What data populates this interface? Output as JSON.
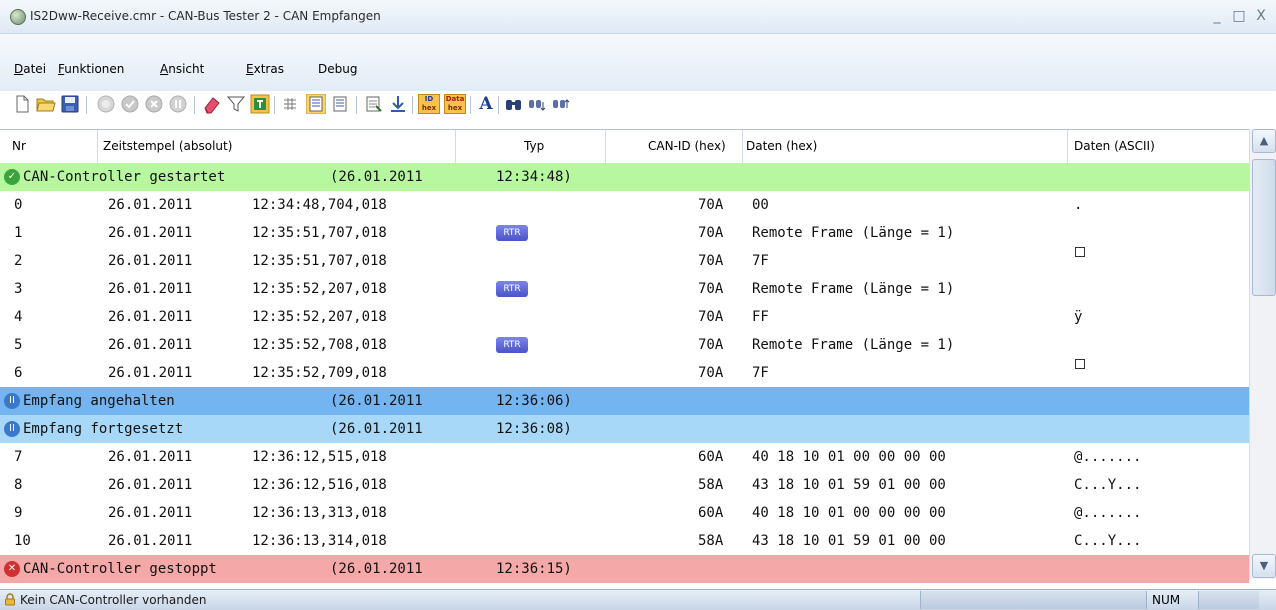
{
  "window": {
    "title": "IS2Dww-Receive.cmr - CAN-Bus Tester 2 - CAN Empfangen",
    "minimize": "_",
    "maximize": "□",
    "close": "X"
  },
  "menu": [
    {
      "label_u": "D",
      "label_rest": "atei"
    },
    {
      "label_u": "F",
      "label_rest": "unktionen"
    },
    {
      "label_u": "A",
      "label_rest": "nsicht"
    },
    {
      "label_u": "E",
      "label_rest": "xtras"
    },
    {
      "label_u": "",
      "label_rest": "Debug"
    }
  ],
  "toolbar": {
    "icons": [
      "new-file-icon",
      "open-folder-icon",
      "save-icon",
      "start-icon",
      "check-icon",
      "stop-icon",
      "pause-icon",
      "eraser-icon",
      "filter-icon",
      "trigger-icon",
      "grid-icon",
      "list-view-icon",
      "detail-view-icon",
      "export-icon",
      "download-icon",
      "id-hex-icon",
      "data-hex-icon",
      "font-icon",
      "find-icon",
      "find-next-icon",
      "find-prev-icon"
    ],
    "id_hex_top": "ID",
    "id_hex_bottom": "hex",
    "data_hex_top": "Data",
    "data_hex_bottom": "hex",
    "font_glyph": "A"
  },
  "columns": {
    "nr": "Nr",
    "timestamp": "Zeitstempel (absolut)",
    "type": "Typ",
    "can_id": "CAN-ID (hex)",
    "data_hex": "Daten (hex)",
    "data_ascii": "Daten (ASCII)"
  },
  "colors": {
    "started": "#b7f7a0",
    "paused": "#74b4f0",
    "resumed": "#a8d8f8",
    "stopped": "#f4a8a8",
    "rtr_badge": "#5a63d6"
  },
  "events": {
    "started": {
      "text": "CAN-Controller gestartet",
      "date": "(26.01.2011",
      "time": "12:34:48)"
    },
    "paused": {
      "text": "Empfang angehalten",
      "date": "(26.01.2011",
      "time": "12:36:06)"
    },
    "resumed": {
      "text": "Empfang fortgesetzt",
      "date": "(26.01.2011",
      "time": "12:36:08)"
    },
    "stopped": {
      "text": "CAN-Controller gestoppt",
      "date": "(26.01.2011",
      "time": "12:36:15)"
    }
  },
  "rtr_label": "RTR",
  "rows": [
    {
      "nr": "0",
      "date": "26.01.2011",
      "time": "12:34:48,704,018",
      "rtr": false,
      "id": "70A",
      "data": "00",
      "ascii": ".",
      "sq": false
    },
    {
      "nr": "1",
      "date": "26.01.2011",
      "time": "12:35:51,707,018",
      "rtr": true,
      "id": "70A",
      "data": "Remote Frame (Länge = 1)",
      "ascii": "",
      "sq": false
    },
    {
      "nr": "2",
      "date": "26.01.2011",
      "time": "12:35:51,707,018",
      "rtr": false,
      "id": "70A",
      "data": "7F",
      "ascii": "",
      "sq": true
    },
    {
      "nr": "3",
      "date": "26.01.2011",
      "time": "12:35:52,207,018",
      "rtr": true,
      "id": "70A",
      "data": "Remote Frame (Länge = 1)",
      "ascii": "",
      "sq": false
    },
    {
      "nr": "4",
      "date": "26.01.2011",
      "time": "12:35:52,207,018",
      "rtr": false,
      "id": "70A",
      "data": "FF",
      "ascii": "ÿ",
      "sq": false
    },
    {
      "nr": "5",
      "date": "26.01.2011",
      "time": "12:35:52,708,018",
      "rtr": true,
      "id": "70A",
      "data": "Remote Frame (Länge = 1)",
      "ascii": "",
      "sq": false
    },
    {
      "nr": "6",
      "date": "26.01.2011",
      "time": "12:35:52,709,018",
      "rtr": false,
      "id": "70A",
      "data": "7F",
      "ascii": "",
      "sq": true
    },
    {
      "nr": "7",
      "date": "26.01.2011",
      "time": "12:36:12,515,018",
      "rtr": false,
      "id": "60A",
      "data": "40 18 10 01 00 00 00 00",
      "ascii": "@.......",
      "sq": false
    },
    {
      "nr": "8",
      "date": "26.01.2011",
      "time": "12:36:12,516,018",
      "rtr": false,
      "id": "58A",
      "data": "43 18 10 01 59 01 00 00",
      "ascii": "C...Y...",
      "sq": false
    },
    {
      "nr": "9",
      "date": "26.01.2011",
      "time": "12:36:13,313,018",
      "rtr": false,
      "id": "60A",
      "data": "40 18 10 01 00 00 00 00",
      "ascii": "@.......",
      "sq": false
    },
    {
      "nr": "10",
      "date": "26.01.2011",
      "time": "12:36:13,314,018",
      "rtr": false,
      "id": "58A",
      "data": "43 18 10 01 59 01 00 00",
      "ascii": "C...Y...",
      "sq": false
    }
  ],
  "statusbar": {
    "message": "Kein CAN-Controller vorhanden",
    "num": "NUM"
  }
}
